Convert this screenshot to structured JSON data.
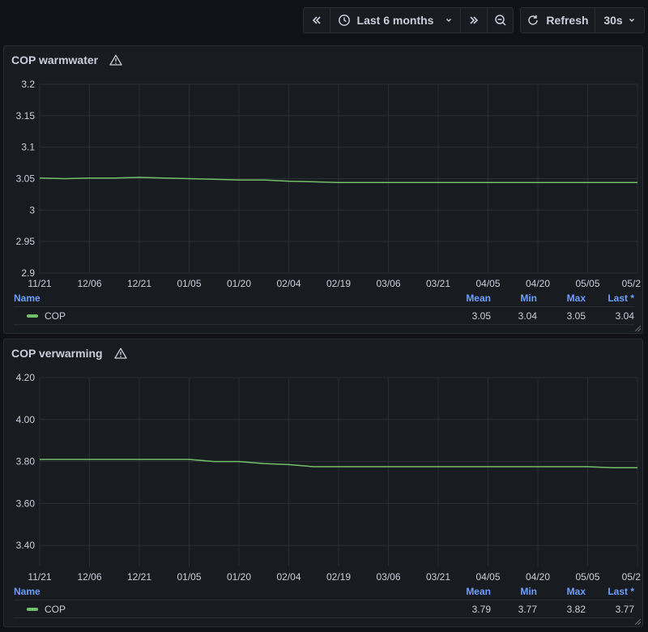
{
  "toolbar": {
    "time_range_label": "Last 6 months",
    "refresh_label": "Refresh",
    "refresh_interval": "30s"
  },
  "colors": {
    "series": "#73bf69",
    "legend_header": "#6e9fff",
    "grid": "#2c2e35"
  },
  "panels": [
    {
      "title": "COP warmwater",
      "legend": {
        "headers": [
          "Name",
          "Mean",
          "Min",
          "Max",
          "Last *"
        ],
        "rows": [
          {
            "name": "COP",
            "mean": "3.05",
            "min": "3.04",
            "max": "3.05",
            "last": "3.04"
          }
        ]
      }
    },
    {
      "title": "COP verwarming",
      "legend": {
        "headers": [
          "Name",
          "Mean",
          "Min",
          "Max",
          "Last *"
        ],
        "rows": [
          {
            "name": "COP",
            "mean": "3.79",
            "min": "3.77",
            "max": "3.82",
            "last": "3.77"
          }
        ]
      }
    }
  ],
  "chart_data": [
    {
      "type": "line",
      "y_ticks": [
        "3.2",
        "3.15",
        "3.1",
        "3.05",
        "3",
        "2.95",
        "2.9"
      ],
      "ylim": [
        2.9,
        3.2
      ],
      "x_ticks": [
        "11/21",
        "12/06",
        "12/21",
        "01/05",
        "01/20",
        "02/04",
        "02/19",
        "03/06",
        "03/21",
        "04/05",
        "04/20",
        "05/05",
        "05/2"
      ],
      "grid": true,
      "series": [
        {
          "name": "COP",
          "x": [
            0,
            0.5,
            1,
            1.5,
            2,
            2.5,
            3,
            3.5,
            4,
            4.5,
            5,
            5.5,
            6,
            6.5,
            7,
            7.5,
            8,
            8.5,
            9,
            9.5,
            10,
            10.5,
            11,
            11.5,
            12
          ],
          "values": [
            3.051,
            3.05,
            3.051,
            3.051,
            3.052,
            3.051,
            3.05,
            3.049,
            3.048,
            3.048,
            3.046,
            3.045,
            3.044,
            3.044,
            3.044,
            3.044,
            3.044,
            3.044,
            3.044,
            3.044,
            3.044,
            3.044,
            3.044,
            3.044,
            3.044
          ]
        }
      ]
    },
    {
      "type": "line",
      "y_ticks": [
        "4.20",
        "4.00",
        "3.80",
        "3.60",
        "3.40"
      ],
      "ylim": [
        3.3,
        4.2
      ],
      "x_ticks": [
        "11/21",
        "12/06",
        "12/21",
        "01/05",
        "01/20",
        "02/04",
        "02/19",
        "03/06",
        "03/21",
        "04/05",
        "04/20",
        "05/05",
        "05/2"
      ],
      "grid": true,
      "series": [
        {
          "name": "COP",
          "x": [
            0,
            0.5,
            1,
            1.5,
            2,
            2.5,
            3,
            3.5,
            4,
            4.5,
            5,
            5.5,
            6,
            6.5,
            7,
            7.5,
            8,
            8.5,
            9,
            9.5,
            10,
            10.5,
            11,
            11.5,
            12
          ],
          "values": [
            3.81,
            3.81,
            3.81,
            3.81,
            3.81,
            3.81,
            3.81,
            3.8,
            3.8,
            3.79,
            3.785,
            3.775,
            3.775,
            3.775,
            3.775,
            3.775,
            3.775,
            3.775,
            3.775,
            3.775,
            3.775,
            3.775,
            3.775,
            3.77,
            3.77
          ]
        }
      ]
    }
  ]
}
